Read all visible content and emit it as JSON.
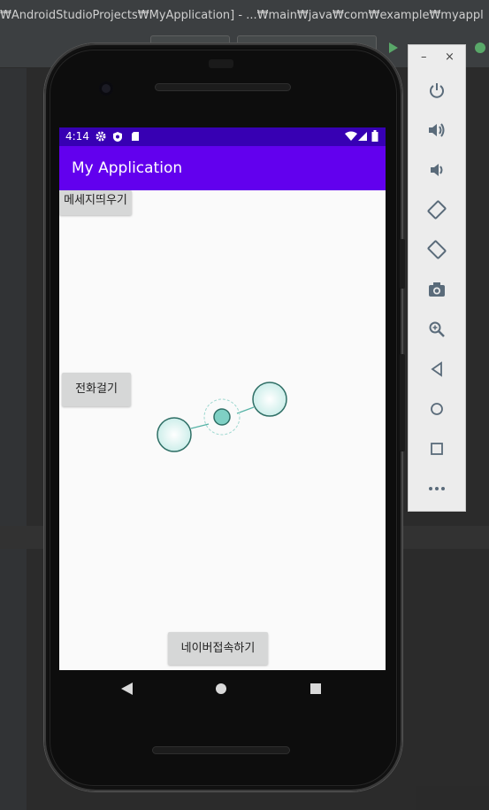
{
  "ide": {
    "title": "₩AndroidStudioProjects₩MyApplication] - ...₩main₩java₩com₩example₩myappl"
  },
  "emulator_toolbar": {
    "minimize": "–",
    "close": "×",
    "items": [
      {
        "icon": "power-icon"
      },
      {
        "icon": "volume-up-icon"
      },
      {
        "icon": "volume-down-icon"
      },
      {
        "icon": "rotate-left-icon"
      },
      {
        "icon": "rotate-right-icon"
      },
      {
        "icon": "camera-icon"
      },
      {
        "icon": "zoom-icon"
      },
      {
        "icon": "back-icon"
      },
      {
        "icon": "home-icon"
      },
      {
        "icon": "overview-icon"
      },
      {
        "icon": "more-icon"
      }
    ]
  },
  "device": {
    "status_bar": {
      "time": "4:14"
    },
    "app_bar": {
      "title": "My Application"
    },
    "buttons": {
      "message": "메세지띄우기",
      "call": "전화걸기",
      "naver": "네이버접속하기"
    }
  },
  "colors": {
    "status_bar": "#3700b3",
    "app_bar": "#6200ee",
    "screen_bg": "#fafafa",
    "button_bg": "#d6d7d7",
    "panel_bg": "#ececec",
    "panel_icon": "#5a6b7a"
  }
}
